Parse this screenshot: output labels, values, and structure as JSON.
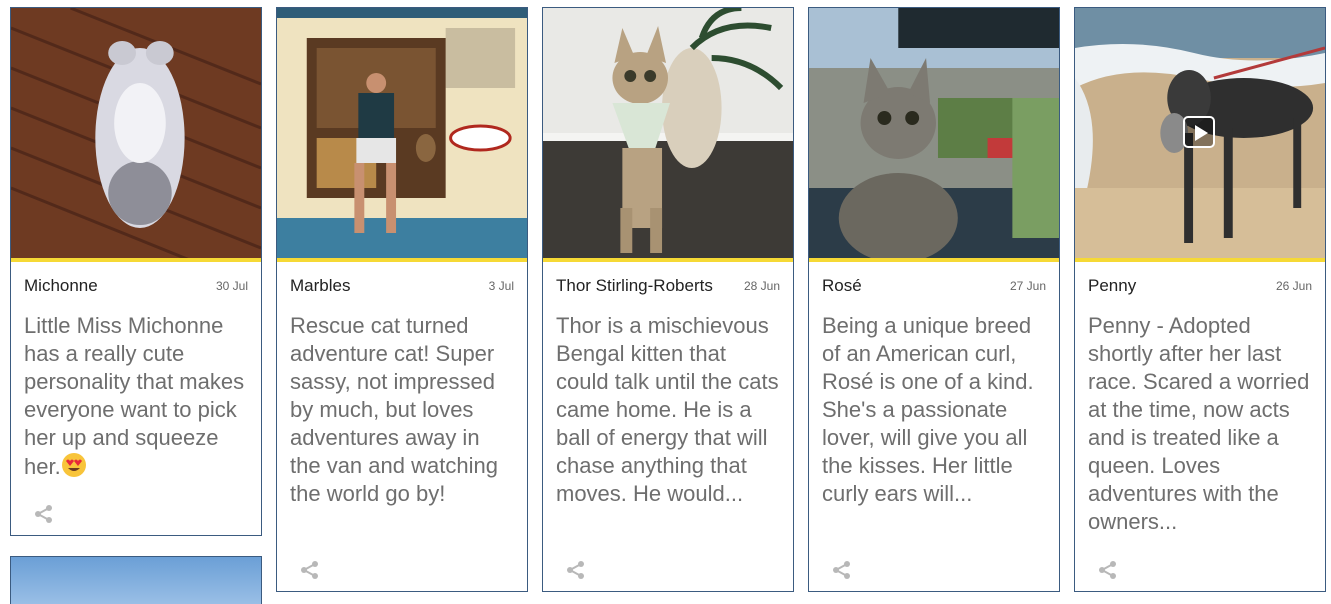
{
  "cards": [
    {
      "name": "Michonne",
      "date": "30 Jul",
      "description": "Little Miss Michonne has a really cute personality that makes everyone want to pick her up and squeeze her.",
      "emoji": "heart-eyes-emoji"
    },
    {
      "name": "Marbles",
      "date": "3 Jul",
      "description": "Rescue cat turned adventure cat! Super sassy, not impressed by much, but loves adventures away in the van and watching the world go by!"
    },
    {
      "name": "Thor Stirling-Roberts",
      "date": "28 Jun",
      "description": "Thor is a mischievous Bengal kitten that could talk until the cats came home. He is a ball of energy that will chase anything that moves. He would..."
    },
    {
      "name": "Rosé",
      "date": "27 Jun",
      "description": "Being a unique breed of an American curl, Rosé is one of a kind. She's a passionate lover, will give you all the kisses. Her little curly ears will..."
    },
    {
      "name": "Penny",
      "date": "26 Jun",
      "description": "Penny - Adopted shortly after her last race. Scared a worried at the time, now acts and is treated like a queen. Loves adventures with the owners...",
      "has_video": true
    }
  ],
  "icons": {
    "share": "share-icon",
    "play": "play-icon"
  },
  "colors": {
    "accent_bar": "#f6d935",
    "card_border": "#3b5b80",
    "description_text": "#6e6e6e",
    "name_text": "#222222"
  }
}
